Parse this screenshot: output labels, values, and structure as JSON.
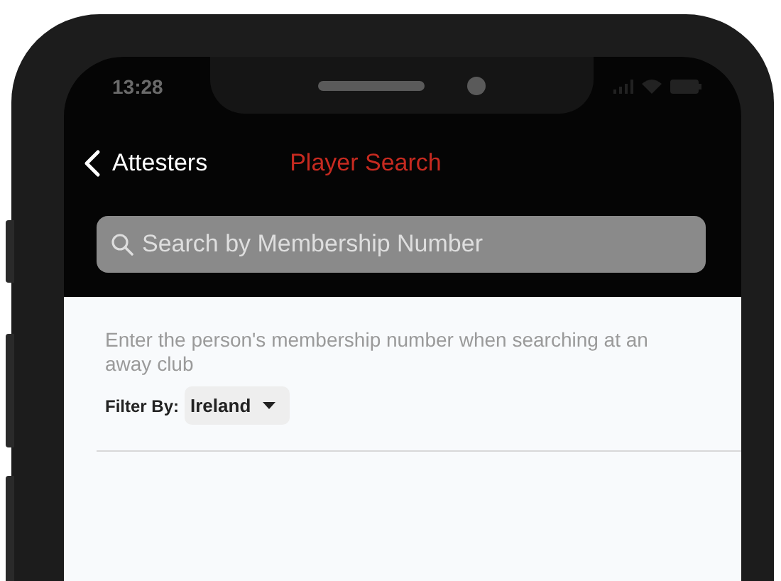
{
  "status_bar": {
    "time": "13:28"
  },
  "nav": {
    "back_label": "Attesters",
    "title": "Player Search"
  },
  "search": {
    "placeholder": "Search by Membership Number"
  },
  "hint": "Enter the person's membership number when searching at an away club",
  "filter": {
    "label": "Filter By:",
    "value": "Ireland"
  }
}
